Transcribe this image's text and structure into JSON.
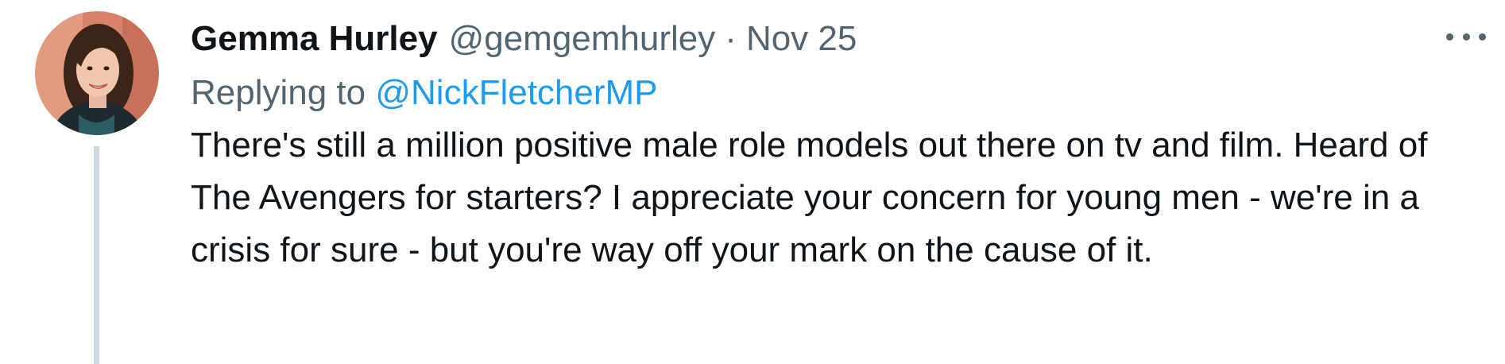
{
  "tweet": {
    "author_name": "Gemma Hurley",
    "author_handle": "@gemgemhurley",
    "separator": "·",
    "date": "Nov 25",
    "replying_prefix": "Replying to",
    "replying_to_handle": "@NickFletcherMP",
    "text": "There's still a million positive male role models out there on tv and film. Heard of The Avengers for starters? I appreciate your concern for young men - we're in a crisis for sure - but you're way off your mark on the cause of it."
  },
  "icons": {
    "more": "more-horizontal-icon",
    "avatar": "profile-avatar"
  },
  "colors": {
    "text_primary": "#0f1419",
    "text_secondary": "#536471",
    "link": "#1d9bf0",
    "thread_line": "#cfd9de",
    "background": "#ffffff"
  }
}
